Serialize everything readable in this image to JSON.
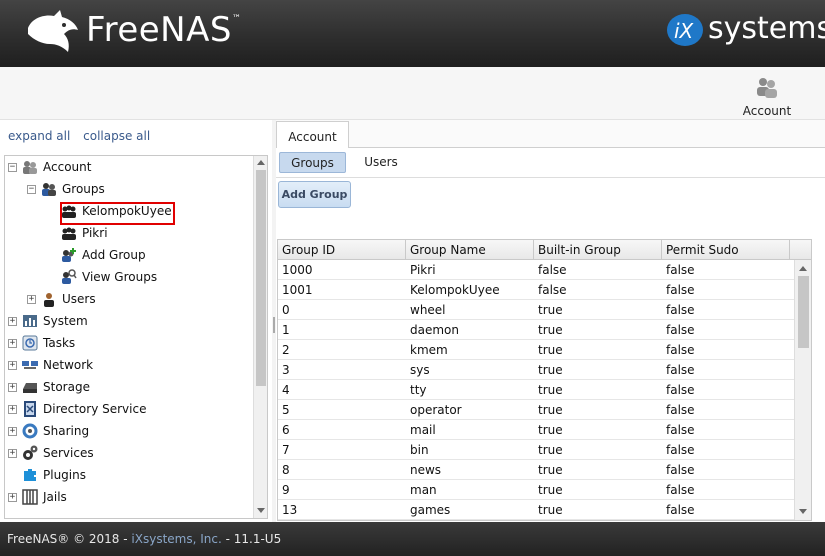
{
  "header": {
    "product": "FreeNAS",
    "trademark": "™",
    "vendor": "systems",
    "vendor_prefix": "iX",
    "vendor_mark": "®"
  },
  "account_button": {
    "label": "Account",
    "icon": "account-users-icon"
  },
  "tree": {
    "expand_all": "expand all",
    "collapse_all": "collapse all",
    "items": [
      {
        "label": "Account",
        "toggle": "−",
        "icon": "account-icon"
      },
      {
        "label": "Groups",
        "toggle": "−",
        "icon": "groups-icon"
      },
      {
        "label": "KelompokUyee",
        "icon": "group-icon"
      },
      {
        "label": "Pikri",
        "icon": "group-icon"
      },
      {
        "label": "Add Group",
        "icon": "add-group-icon"
      },
      {
        "label": "View Groups",
        "icon": "view-groups-icon"
      },
      {
        "label": "Users",
        "toggle": "+",
        "icon": "user-icon"
      },
      {
        "label": "System",
        "toggle": "+",
        "icon": "system-icon"
      },
      {
        "label": "Tasks",
        "toggle": "+",
        "icon": "tasks-icon"
      },
      {
        "label": "Network",
        "toggle": "+",
        "icon": "network-icon"
      },
      {
        "label": "Storage",
        "toggle": "+",
        "icon": "storage-icon"
      },
      {
        "label": "Directory Service",
        "toggle": "+",
        "icon": "directory-service-icon"
      },
      {
        "label": "Sharing",
        "toggle": "+",
        "icon": "sharing-icon"
      },
      {
        "label": "Services",
        "toggle": "+",
        "icon": "services-icon"
      },
      {
        "label": "Plugins",
        "icon": "plugins-icon"
      },
      {
        "label": "Jails",
        "toggle": "+",
        "icon": "jails-icon"
      }
    ]
  },
  "tabs": {
    "top": "Account",
    "sub": [
      "Groups",
      "Users"
    ]
  },
  "toolbar": {
    "add_group": "Add Group"
  },
  "grid": {
    "columns": [
      "Group ID",
      "Group Name",
      "Built-in Group",
      "Permit Sudo"
    ],
    "rows": [
      [
        "1000",
        "Pikri",
        "false",
        "false"
      ],
      [
        "1001",
        "KelompokUyee",
        "false",
        "false"
      ],
      [
        "0",
        "wheel",
        "true",
        "false"
      ],
      [
        "1",
        "daemon",
        "true",
        "false"
      ],
      [
        "2",
        "kmem",
        "true",
        "false"
      ],
      [
        "3",
        "sys",
        "true",
        "false"
      ],
      [
        "4",
        "tty",
        "true",
        "false"
      ],
      [
        "5",
        "operator",
        "true",
        "false"
      ],
      [
        "6",
        "mail",
        "true",
        "false"
      ],
      [
        "7",
        "bin",
        "true",
        "false"
      ],
      [
        "8",
        "news",
        "true",
        "false"
      ],
      [
        "9",
        "man",
        "true",
        "false"
      ],
      [
        "13",
        "games",
        "true",
        "false"
      ]
    ]
  },
  "footer": {
    "text": "FreeNAS® © 2018 - ",
    "link": "iXsystems, Inc.",
    "version": " - 11.1-U5"
  },
  "colors": {
    "accent": "#1f78c8",
    "highlight": "#e00000",
    "tab_active": "#c7d9ee"
  }
}
